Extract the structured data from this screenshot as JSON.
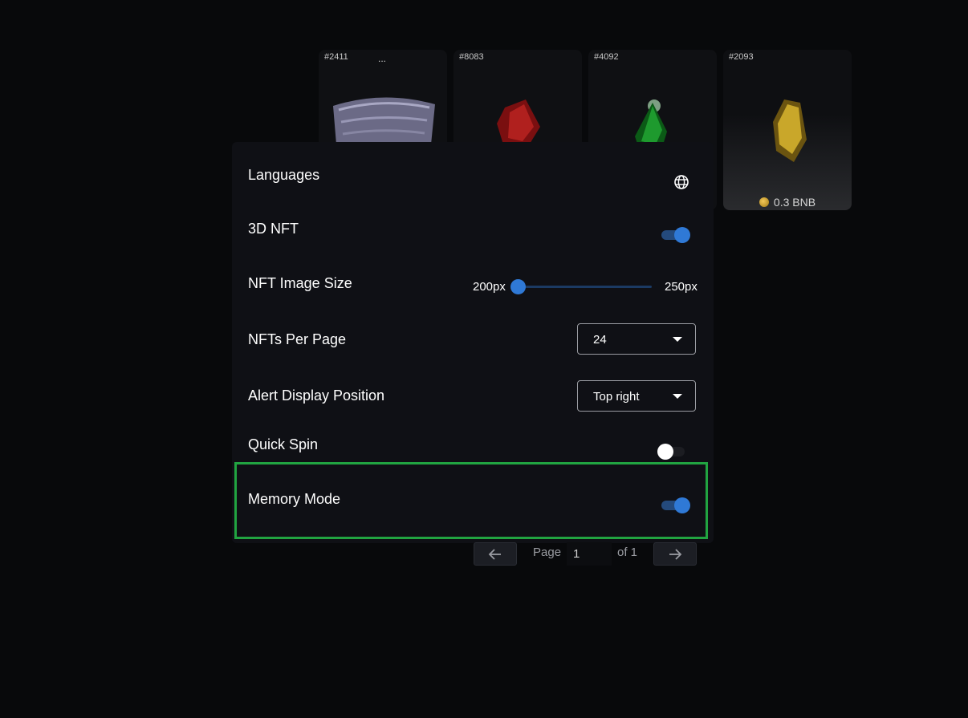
{
  "cards": [
    {
      "number": "#2411",
      "dots": "..."
    },
    {
      "number": "#8083"
    },
    {
      "number": "#4092"
    },
    {
      "number": "#2093",
      "price": "0.3 BNB"
    }
  ],
  "settings": {
    "languages_label": "Languages",
    "nft3d_label": "3D NFT",
    "nft3d_on": true,
    "image_size_label": "NFT Image Size",
    "image_size_min": "200px",
    "image_size_max": "250px",
    "image_size_value": 0,
    "per_page_label": "NFTs Per Page",
    "per_page_value": "24",
    "alert_label": "Alert Display Position",
    "alert_value": "Top right",
    "quick_spin_label": "Quick Spin",
    "quick_spin_on": false,
    "memory_label": "Memory Mode",
    "memory_on": true,
    "highlight_color": "#21a441"
  },
  "pagination": {
    "prev_icon": "arrow-left-icon",
    "page_label": "Page",
    "page_value": "1",
    "of_label": "of 1",
    "next_icon": "arrow-right-icon"
  },
  "colors": {
    "accent": "#2f79d6",
    "background": "#08090b",
    "panel": "#0f1015"
  }
}
